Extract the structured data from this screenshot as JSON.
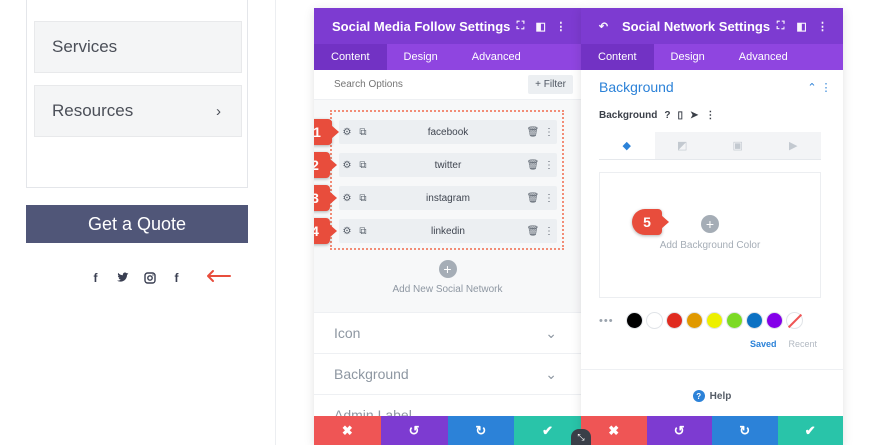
{
  "site": {
    "menu_items": [
      {
        "label": "Services"
      },
      {
        "label": "Resources",
        "chevron": "›"
      }
    ],
    "quote_button": "Get a Quote",
    "social_icons": [
      "facebook-icon",
      "twitter-icon",
      "instagram-icon",
      "facebook-icon"
    ],
    "arrow_color": "#e84d3c"
  },
  "follow_panel": {
    "title": "Social Media Follow Settings",
    "tabs": [
      "Content",
      "Design",
      "Advanced"
    ],
    "active_tab": "Content",
    "search_placeholder": "Search Options",
    "filter_label": "+ Filter",
    "networks": [
      {
        "badge": "1",
        "label": "facebook"
      },
      {
        "badge": "2",
        "label": "twitter"
      },
      {
        "badge": "3",
        "label": "instagram"
      },
      {
        "badge": "4",
        "label": "linkedin"
      }
    ],
    "add_network_label": "Add New Social Network",
    "sections": [
      "Icon",
      "Background",
      "Admin Label"
    ]
  },
  "network_panel": {
    "title": "Social Network Settings",
    "tabs": [
      "Content",
      "Design",
      "Advanced"
    ],
    "active_tab": "Content",
    "background_heading": "Background",
    "background_label": "Background",
    "add_color_label": "Add Background Color",
    "badge": "5",
    "swatch_colors": [
      "#000000",
      "#ffffff",
      "#e02b20",
      "#e09900",
      "#edf000",
      "#7cda24",
      "#0c71c3",
      "#8300e9"
    ],
    "saved_label": "Saved",
    "recent_label": "Recent",
    "help_label": "Help"
  },
  "colors": {
    "header_purple": "#7d3bd1",
    "accent_blue": "#2c82d8",
    "badge_red": "#e84d3c",
    "footer": [
      "#ef5555",
      "#7d3bd1",
      "#2c82d8",
      "#29c4a9"
    ]
  }
}
